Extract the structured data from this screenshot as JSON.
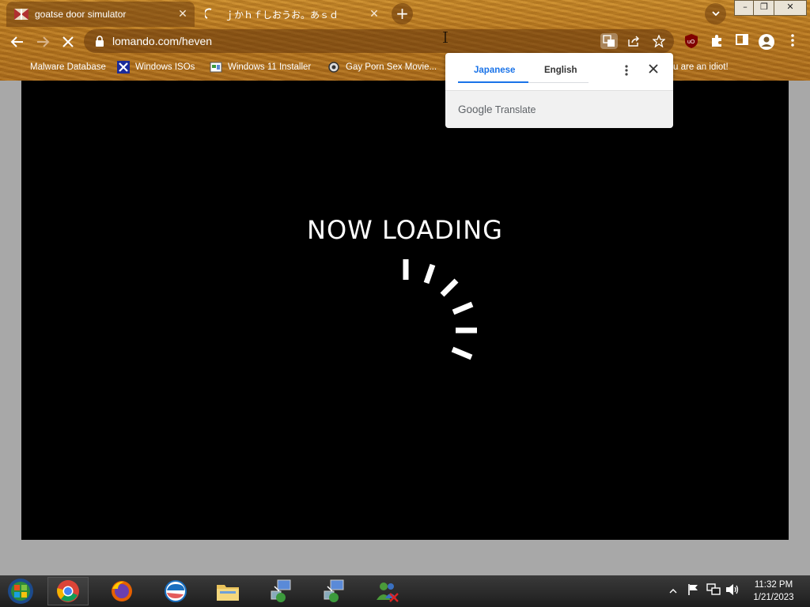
{
  "browser": {
    "tabs": [
      {
        "title": "goatse door simulator",
        "close": "✕"
      },
      {
        "title": "ｊかｈｆしおうお。あｓｄ",
        "close": "✕"
      }
    ],
    "new_tab": "+",
    "tab_search": "⌄",
    "window_controls": {
      "minimize": "–",
      "restore": "❐",
      "close": "✕"
    },
    "url": "lomando.com/heven",
    "bookmarks": [
      {
        "label": "Malware Database"
      },
      {
        "label": "Windows ISOs"
      },
      {
        "label": "Windows 11 Installer"
      },
      {
        "label": "Gay Porn Sex Movie..."
      },
      {
        "label": "u are an idiot!"
      }
    ]
  },
  "translate_popup": {
    "tabs": [
      "Japanese",
      "English"
    ],
    "selected": "Japanese",
    "footer": "Google Translate",
    "footer_brand": "Google",
    "footer_product": "Translate",
    "accent": "#1a73e8"
  },
  "page": {
    "loading_text": "NOW LOADING"
  },
  "taskbar": {
    "apps": [
      "start-orb",
      "chrome",
      "firefox",
      "internet-explorer",
      "file-explorer",
      "network-app-1",
      "network-app-2",
      "messenger"
    ],
    "time": "11:32 PM",
    "date": "1/21/2023"
  }
}
